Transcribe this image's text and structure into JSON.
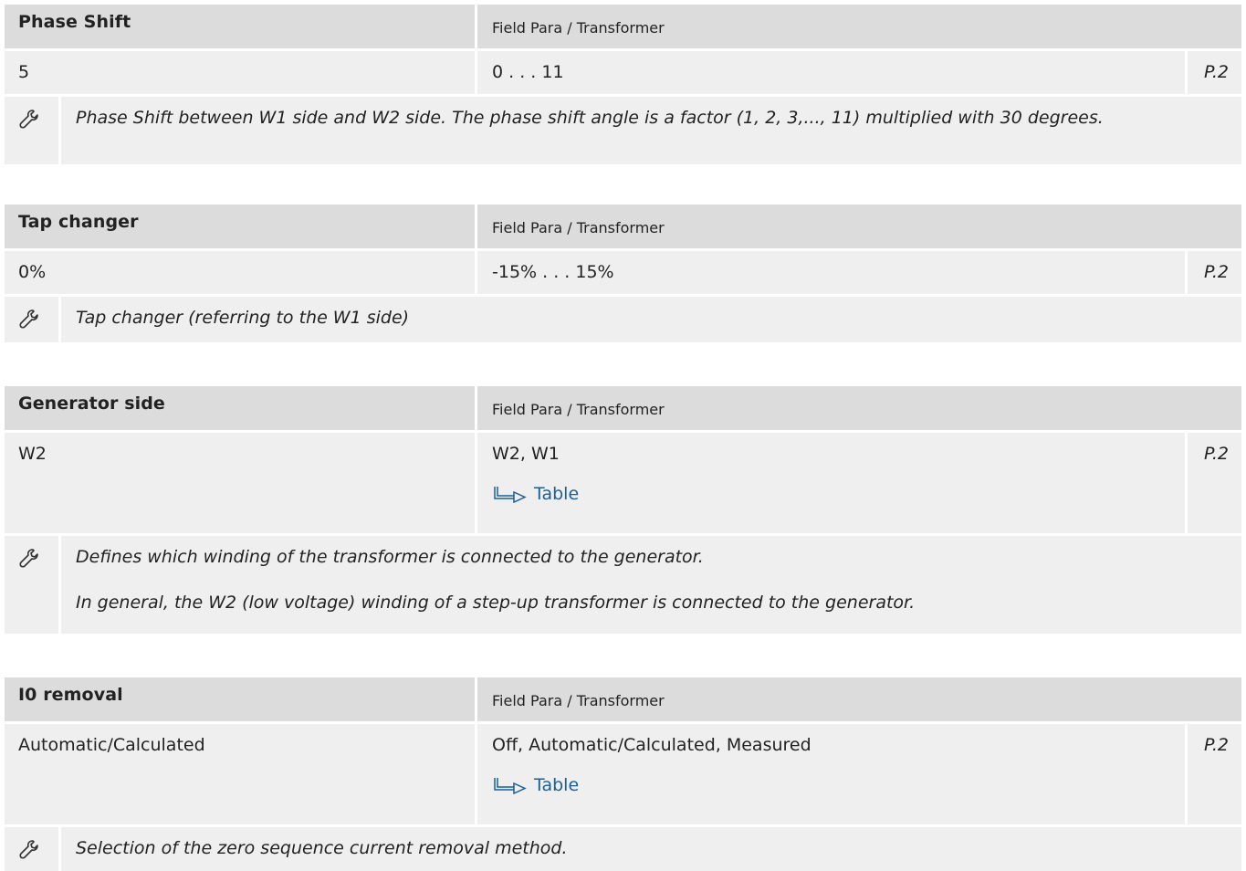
{
  "params": [
    {
      "name": "Phase Shift",
      "path": "Field Para / Transformer",
      "default": "5",
      "range": "0 . . . 11",
      "protection": "P.2",
      "description": [
        "Phase Shift between W1 side and W2 side. The phase shift angle is a factor (1, 2, 3,..., 11) multiplied with 30 degrees."
      ]
    },
    {
      "name": "Tap changer",
      "path": "Field Para / Transformer",
      "default": "0%",
      "range": "-15% . . . 15%",
      "protection": "P.2",
      "description": [
        "Tap changer (referring to the W1 side)"
      ]
    },
    {
      "name": "Generator side",
      "path": "Field Para / Transformer",
      "default": "W2",
      "range": "W2, W1",
      "link": "Table",
      "protection": "P.2",
      "description": [
        "Defines which winding of the transformer is connected to the generator.",
        "In general, the W2 (low voltage) winding of a step-up transformer is connected to the generator."
      ]
    },
    {
      "name": "I0 removal",
      "path": "Field Para / Transformer",
      "default": "Automatic/Calculated",
      "range": "Off, Automatic/Calculated, Measured",
      "link": "Table",
      "protection": "P.2",
      "description": [
        "Selection of the zero sequence current removal method."
      ]
    }
  ],
  "icons": {
    "description": "wrench-icon",
    "link": "table-link-arrow-icon"
  },
  "colors": {
    "header": "#dcdcdc",
    "body": "#efefef",
    "link": "#1a5f9a"
  }
}
